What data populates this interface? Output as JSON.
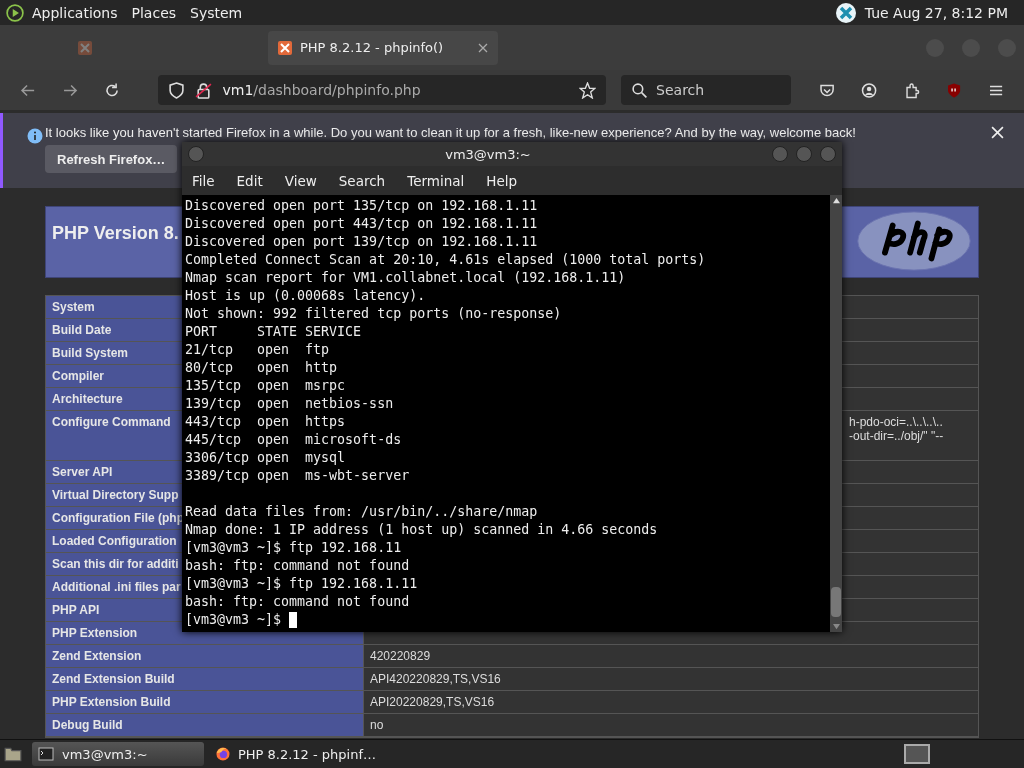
{
  "top_panel": {
    "menus": [
      "Applications",
      "Places",
      "System"
    ],
    "clock": "Tue Aug 27,  8:12 PM"
  },
  "browser": {
    "tabs": [
      {
        "selected": false
      },
      {
        "label": "PHP 8.2.12 - phpinfo()",
        "selected": true
      }
    ],
    "address": {
      "host": "vm1",
      "path": "/dashboard/phpinfo.php"
    },
    "search": {
      "placeholder": "Search"
    },
    "notification": {
      "message": "It looks like you haven't started Firefox in a while. Do you want to clean it up for a fresh, like-new experience? And by the way, welcome back!",
      "button": "Refresh Firefox…"
    }
  },
  "phpinfo": {
    "title": "PHP Version 8.",
    "rows": [
      {
        "label": "System"
      },
      {
        "label": "Build Date"
      },
      {
        "label": "Build System"
      },
      {
        "label": "Compiler"
      },
      {
        "label": "Architecture"
      },
      {
        "label": "Configure Command",
        "value_lines": [
          "h-pdo-oci=..\\..\\..\\..",
          "-out-dir=../obj/\" \"--"
        ]
      },
      {
        "label": "Server API"
      },
      {
        "label": "Virtual Directory Supp"
      },
      {
        "label": "Configuration File (php"
      },
      {
        "label": "Loaded Configuration"
      },
      {
        "label": "Scan this dir for additi"
      },
      {
        "label": "Additional .ini files par"
      },
      {
        "label": "PHP API"
      },
      {
        "label": "PHP Extension"
      },
      {
        "label": "Zend Extension",
        "value": "420220829"
      },
      {
        "label": "Zend Extension Build",
        "value": "API420220829,TS,VS16"
      },
      {
        "label": "PHP Extension Build",
        "value": "API20220829,TS,VS16"
      },
      {
        "label": "Debug Build",
        "value": "no"
      }
    ]
  },
  "terminal": {
    "title": "vm3@vm3:~",
    "menus": [
      "File",
      "Edit",
      "View",
      "Search",
      "Terminal",
      "Help"
    ],
    "blocks": [
      [
        "Discovered open port 135/tcp on 192.168.1.11",
        "Discovered open port 443/tcp on 192.168.1.11",
        "Discovered open port 139/tcp on 192.168.1.11",
        "Completed Connect Scan at 20:10, 4.61s elapsed (1000 total ports)",
        "Nmap scan report for VM1.collabnet.local (192.168.1.11)",
        "Host is up (0.00068s latency).",
        "Not shown: 992 filtered tcp ports (no-response)",
        "PORT     STATE SERVICE",
        "21/tcp   open  ftp",
        "80/tcp   open  http",
        "135/tcp  open  msrpc",
        "139/tcp  open  netbios-ssn",
        "443/tcp  open  https",
        "445/tcp  open  microsoft-ds",
        "3306/tcp open  mysql",
        "3389/tcp open  ms-wbt-server"
      ],
      [
        "Read data files from: /usr/bin/../share/nmap",
        "Nmap done: 1 IP address (1 host up) scanned in 4.66 seconds",
        "[vm3@vm3 ~]$ ftp 192.168.11",
        "bash: ftp: command not found",
        "[vm3@vm3 ~]$ ftp 192.168.1.11",
        "bash: ftp: command not found",
        "[vm3@vm3 ~]$"
      ]
    ]
  },
  "taskbar": {
    "tasks": [
      {
        "kind": "terminal",
        "label": "vm3@vm3:~",
        "selected": true
      },
      {
        "kind": "browser",
        "label": "PHP 8.2.12 - phpinf…",
        "selected": false
      }
    ]
  }
}
